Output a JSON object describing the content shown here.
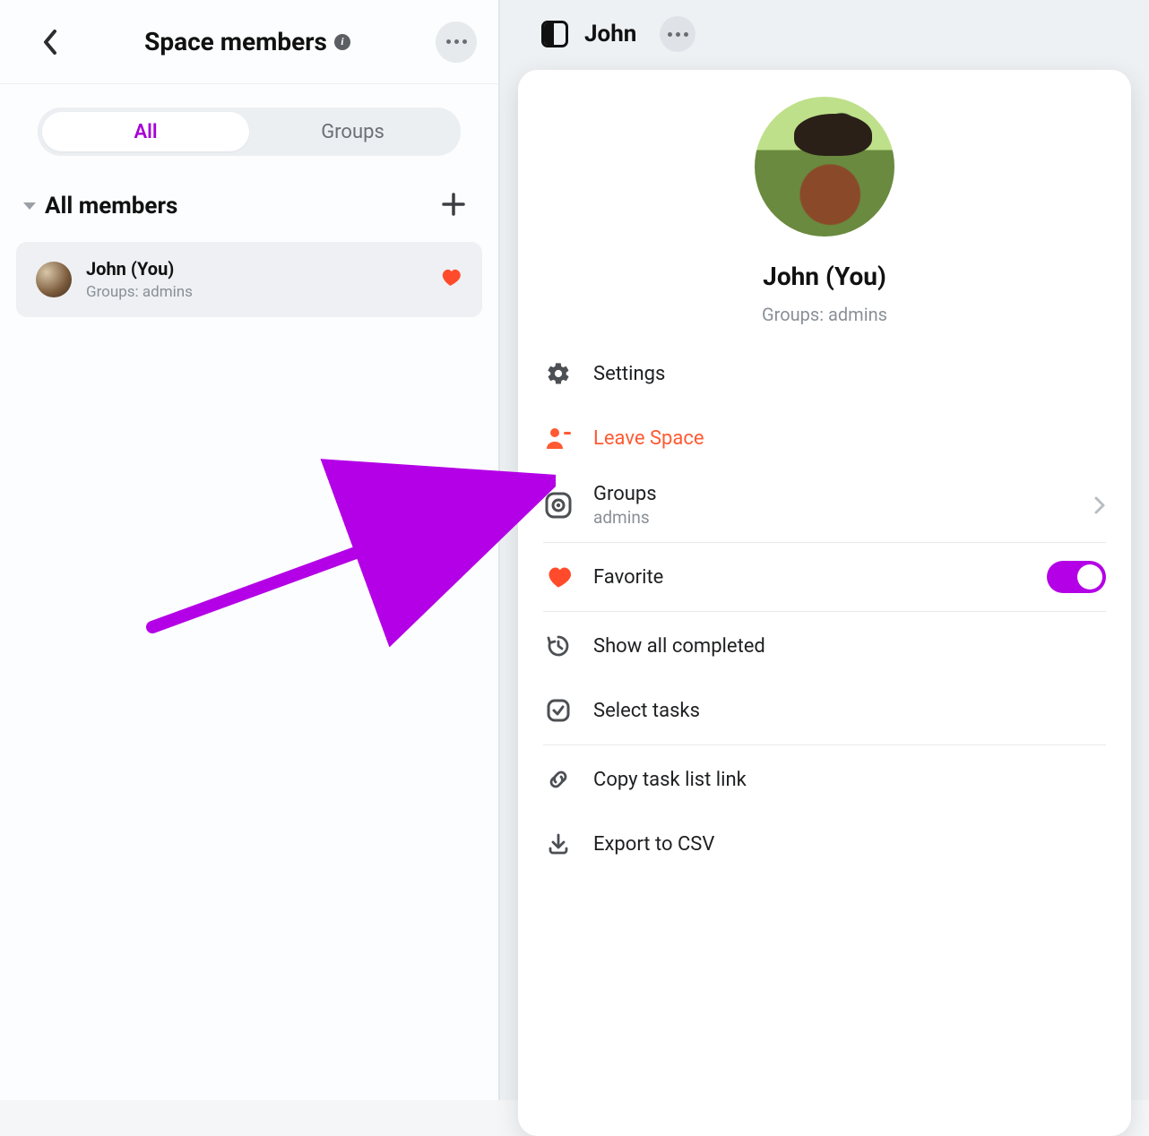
{
  "left": {
    "title": "Space members",
    "tabs": {
      "all": "All",
      "groups": "Groups"
    },
    "section_title": "All members",
    "member": {
      "name": "John (You)",
      "groups_label": "Groups: admins"
    }
  },
  "right": {
    "title": "John"
  },
  "card": {
    "name": "John (You)",
    "groups_label": "Groups: admins",
    "menu": {
      "settings": "Settings",
      "leave": "Leave Space",
      "groups": "Groups",
      "groups_value": "admins",
      "favorite": "Favorite",
      "show_completed": "Show all completed",
      "select_tasks": "Select tasks",
      "copy_link": "Copy task list link",
      "export_csv": "Export to CSV"
    }
  },
  "colors": {
    "accent": "#b400e6",
    "danger": "#ff5a33",
    "heart": "#ff4b2b"
  }
}
